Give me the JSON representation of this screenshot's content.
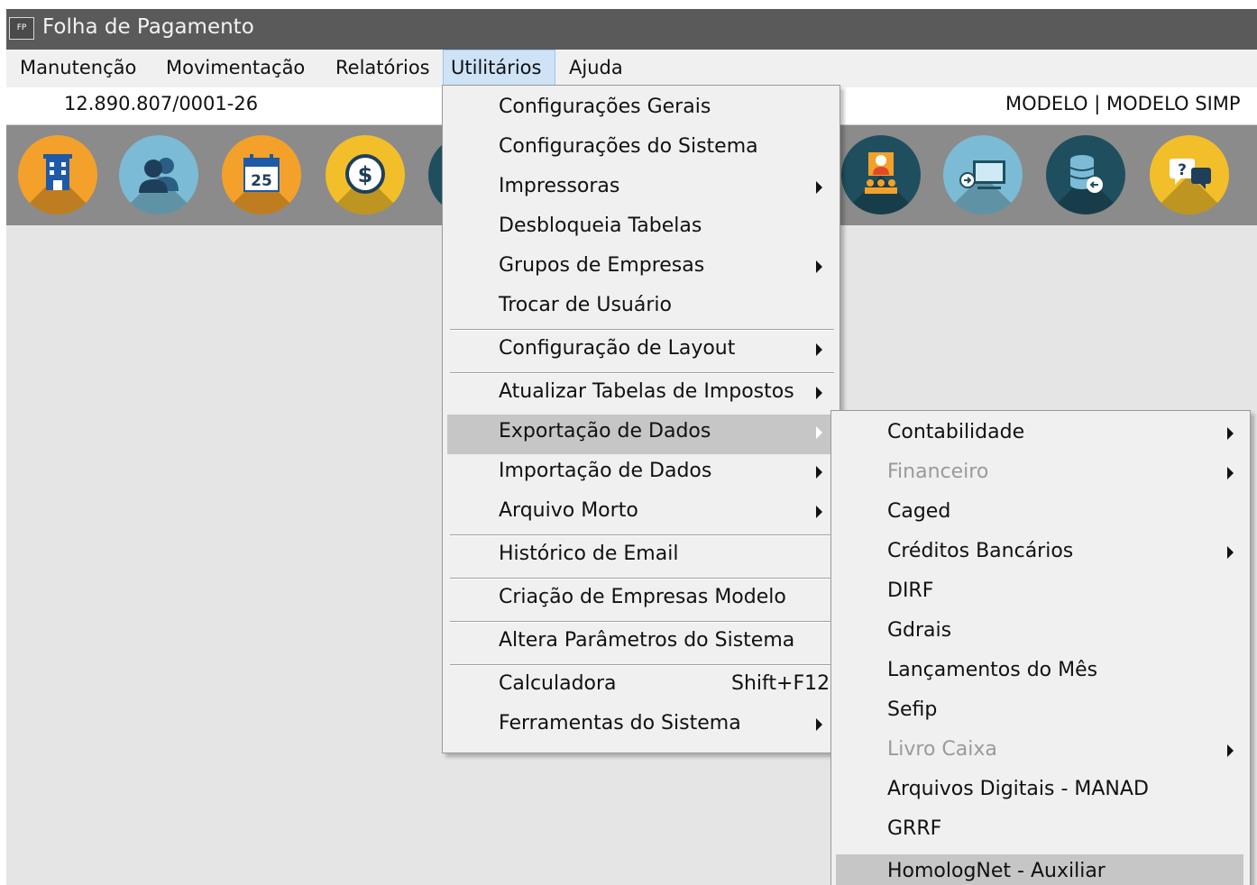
{
  "window": {
    "icon_text": "FP",
    "title": "Folha de Pagamento"
  },
  "menubar": [
    "Manutenção",
    "Movimentação",
    "Relatórios",
    "Utilitários",
    "Ajuda"
  ],
  "company": {
    "cnpj": "12.890.807/0001-26",
    "name": "MODELO | MODELO SIMP"
  },
  "toolbar": {
    "icons": [
      "building-icon",
      "users-icon",
      "calendar-icon",
      "dollar-icon",
      "partial-icon",
      "employees-icon",
      "remote-access-icon",
      "database-icon",
      "help-chat-icon"
    ],
    "calendar_day": "25",
    "help_mark": "?"
  },
  "utilitarios_menu": {
    "items": [
      {
        "label": "Configurações Gerais"
      },
      {
        "label": "Configurações do Sistema"
      },
      {
        "label": "Impressoras",
        "submenu": true
      },
      {
        "label": "Desbloqueia Tabelas"
      },
      {
        "label": "Grupos de Empresas",
        "submenu": true
      },
      {
        "label": "Trocar de Usuário"
      },
      {
        "label": "Configuração de Layout",
        "submenu": true
      },
      {
        "label": "Atualizar Tabelas de Impostos",
        "submenu": true
      },
      {
        "label": "Exportação de Dados",
        "submenu": true,
        "highlighted": true
      },
      {
        "label": "Importação de Dados",
        "submenu": true
      },
      {
        "label": "Arquivo Morto",
        "submenu": true
      },
      {
        "label": "Histórico de Email"
      },
      {
        "label": "Criação de Empresas Modelo"
      },
      {
        "label": "Altera Parâmetros do Sistema"
      },
      {
        "label": "Calculadora",
        "shortcut": "Shift+F12"
      },
      {
        "label": "Ferramentas do Sistema",
        "submenu": true
      }
    ]
  },
  "exportacao_menu": {
    "items": [
      {
        "label": "Contabilidade",
        "submenu": true
      },
      {
        "label": "Financeiro",
        "submenu": true,
        "disabled": true
      },
      {
        "label": "Caged"
      },
      {
        "label": "Créditos Bancários",
        "submenu": true
      },
      {
        "label": "DIRF"
      },
      {
        "label": "Gdrais"
      },
      {
        "label": "Lançamentos do Mês"
      },
      {
        "label": "Sefip"
      },
      {
        "label": "Livro Caixa",
        "submenu": true,
        "disabled": true
      },
      {
        "label": "Arquivos Digitais - MANAD"
      },
      {
        "label": "GRRF"
      },
      {
        "label": "HomologNet - Auxiliar",
        "highlighted": true
      }
    ]
  },
  "colors": {
    "titlebar": "#5a5a5a",
    "toolbar": "#8b8b8b",
    "orange": "#f3a12a",
    "light_blue": "#7bbbd5",
    "yellow": "#f2bf2a",
    "dark_teal": "#1f4f5f",
    "highlight": "#c6c6c6"
  }
}
